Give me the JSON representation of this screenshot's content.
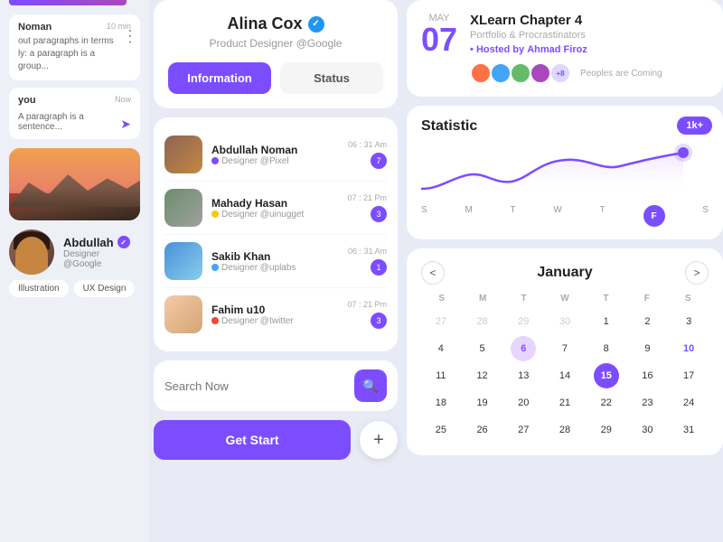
{
  "left": {
    "chat1": {
      "name": "Noman",
      "time": "10 min",
      "text": "out paragraphs in terms\nly: a paragraph is a\ngroup..."
    },
    "chat2": {
      "name": "you",
      "time": "Now",
      "text": "A paragraph is a sentence..."
    },
    "profile": {
      "name": "Abdullah",
      "verified": "✓",
      "role": "Designer @Google",
      "tag1": "Illustration",
      "tag2": "UX Design"
    }
  },
  "center": {
    "profile": {
      "name": "Alina Cox",
      "verified": "✓",
      "role": "Product Designer @Google"
    },
    "btn_info": "Information",
    "btn_status": "Status",
    "contacts": [
      {
        "name": "Abdullah Noman",
        "role": "Designer @Pixel",
        "time": "06 : 31 Am",
        "count": "7",
        "dotColor": "#7c4dff"
      },
      {
        "name": "Mahady Hasan",
        "role": "Designer @uinugget",
        "time": "07 : 21 Pm",
        "count": "3",
        "dotColor": "#f6c90e"
      },
      {
        "name": "Sakib Khan",
        "role": "Designer @uplabs",
        "time": "06 : 31 Am",
        "count": "1",
        "dotColor": "#42a5f5"
      },
      {
        "name": "Fahim u10",
        "role": "Designer @twitter",
        "time": "07 : 21 Pm",
        "count": "3",
        "dotColor": "#f44336"
      }
    ],
    "search_placeholder": "Search Now",
    "get_start": "Get Start",
    "plus": "+"
  },
  "right": {
    "event": {
      "month": "May",
      "day": "07",
      "title": "XLearn Chapter 4",
      "subtitle": "Portfolio & Procrastinators",
      "host_prefix": "• Hosted by",
      "host_name": "Ahmad Firoz",
      "attendee_count": "+8",
      "attendee_text": "Peoples are Coming"
    },
    "statistic": {
      "title": "Statistic",
      "badge": "1k+",
      "days": [
        "S",
        "M",
        "T",
        "W",
        "T",
        "F",
        "S"
      ],
      "active_day": "F"
    },
    "calendar": {
      "title": "January",
      "days_header": [
        "S",
        "M",
        "T",
        "W",
        "T",
        "F",
        "S"
      ],
      "prev": "<",
      "next": ">",
      "cells": [
        {
          "val": "27",
          "type": "other"
        },
        {
          "val": "28",
          "type": "other"
        },
        {
          "val": "29",
          "type": "other"
        },
        {
          "val": "30",
          "type": "other"
        },
        {
          "val": "1",
          "type": "normal"
        },
        {
          "val": "2",
          "type": "normal"
        },
        {
          "val": "3",
          "type": "normal"
        },
        {
          "val": "4",
          "type": "normal"
        },
        {
          "val": "5",
          "type": "normal"
        },
        {
          "val": "6",
          "type": "highlight"
        },
        {
          "val": "7",
          "type": "normal"
        },
        {
          "val": "8",
          "type": "normal"
        },
        {
          "val": "9",
          "type": "normal"
        },
        {
          "val": "10",
          "type": "bold"
        },
        {
          "val": "11",
          "type": "normal"
        },
        {
          "val": "12",
          "type": "normal"
        },
        {
          "val": "13",
          "type": "normal"
        },
        {
          "val": "14",
          "type": "normal"
        },
        {
          "val": "15",
          "type": "today"
        },
        {
          "val": "16",
          "type": "normal"
        },
        {
          "val": "17",
          "type": "normal"
        },
        {
          "val": "18",
          "type": "normal"
        },
        {
          "val": "19",
          "type": "normal"
        },
        {
          "val": "20",
          "type": "normal"
        },
        {
          "val": "21",
          "type": "normal"
        },
        {
          "val": "22",
          "type": "normal"
        },
        {
          "val": "23",
          "type": "normal"
        },
        {
          "val": "24",
          "type": "normal"
        },
        {
          "val": "25",
          "type": "normal"
        },
        {
          "val": "26",
          "type": "normal"
        },
        {
          "val": "27",
          "type": "normal"
        },
        {
          "val": "28",
          "type": "normal"
        },
        {
          "val": "29",
          "type": "normal"
        },
        {
          "val": "30",
          "type": "normal"
        },
        {
          "val": "31",
          "type": "normal"
        }
      ]
    }
  }
}
